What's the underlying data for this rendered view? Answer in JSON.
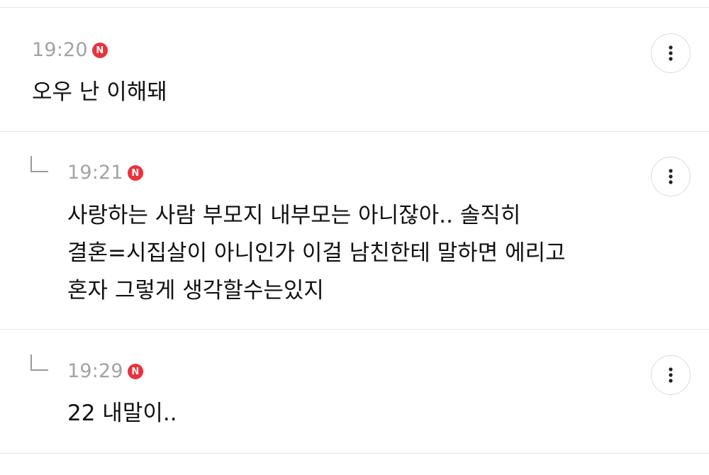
{
  "comments": [
    {
      "time": "19:20",
      "badge": "N",
      "text": "오우 난 이해돼"
    },
    {
      "time": "19:21",
      "badge": "N",
      "text": "사랑하는 사람 부모지 내부모는 아니잖아.. 솔직히\n결혼=시집살이 아니인가 이걸 남친한테 말하면 에리고\n혼자 그렇게 생각할수는있지"
    },
    {
      "time": "19:29",
      "badge": "N",
      "text": "22 내말이.."
    }
  ],
  "icons": {
    "more": "more-vertical-icon",
    "reply": "reply-arrow-icon"
  },
  "colors": {
    "badge": "#e8333c",
    "timestamp": "#a3a3a3",
    "divider": "#e6e6e6"
  }
}
